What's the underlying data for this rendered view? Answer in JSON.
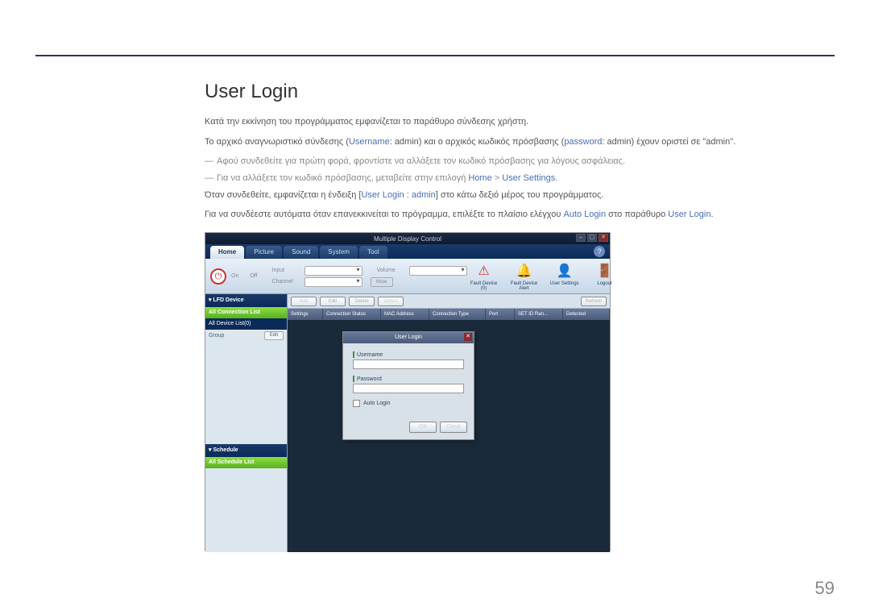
{
  "document": {
    "title": "User Login",
    "page_number": "59",
    "paragraphs": {
      "p1": "Κατά την εκκίνηση του προγράμματος εμφανίζεται το παράθυρο σύνδεσης χρήστη.",
      "p2a": "Το αρχικό αναγνωριστικό σύνδεσης (",
      "p2b": "Username",
      "p2c": ": admin) και ο αρχικός κωδικός πρόσβασης (",
      "p2d": "password",
      "p2e": ": admin) έχουν οριστεί σε \"admin\".",
      "d1": "Αφού συνδεθείτε για πρώτη φορά, φροντίστε να αλλάξετε τον κωδικό πρόσβασης για λόγους ασφάλειας.",
      "d2a": "Για να αλλάξετε τον κωδικό πρόσβασης, μεταβείτε στην επιλογή ",
      "d2b": "Home",
      "d2c": " > ",
      "d2d": "User Settings",
      "d2e": ".",
      "p3a": "Όταν συνδεθείτε, εμφανίζεται η ένδειξη [",
      "p3b": "User Login : admin",
      "p3c": "] στο κάτω δεξιό μέρος του προγράμματος.",
      "p4a": "Για να συνδέεστε αυτόματα όταν επανεκκινείται το πρόγραμμα, επιλέξτε το πλαίσιο ελέγχου ",
      "p4b": "Auto Login",
      "p4c": " στο παράθυρο ",
      "p4d": "User Login",
      "p4e": "."
    }
  },
  "app": {
    "window_title": "Multiple Display Control",
    "help": "?",
    "tabs": [
      "Home",
      "Picture",
      "Sound",
      "System",
      "Tool"
    ],
    "toolbar": {
      "on": "On",
      "off": "Off",
      "input_label": "Input",
      "channel_label": "Channel",
      "volume_label": "Volume",
      "mute": "Mute",
      "icons": [
        {
          "name": "fault-device-icon",
          "glyph": "❗",
          "label": "Fault Device (0)"
        },
        {
          "name": "fault-alert-icon",
          "glyph": "🔔",
          "label": "Fault Device Alert"
        },
        {
          "name": "user-settings-icon",
          "glyph": "👤",
          "label": "User Settings"
        },
        {
          "name": "logout-icon",
          "glyph": "🚪",
          "label": "Logout"
        }
      ]
    },
    "sidebar": {
      "lfd_header": "▾ LFD Device",
      "all_connection": "All Connection List",
      "all_device": "All Device List(0)",
      "group": "Group",
      "edit": "Edit",
      "schedule_header": "▾ Schedule",
      "all_schedule": "All Schedule List"
    },
    "crud": {
      "add": "Add",
      "edit": "Edit",
      "delete": "Delete",
      "detect": "Detect",
      "refresh": "Refresh"
    },
    "table_headers": [
      "Settings",
      "Connection Status",
      "MAC Address",
      "Connection Type",
      "Port",
      "SET ID Ran...",
      "Detected"
    ],
    "login": {
      "title": "User Login",
      "username": "Username",
      "password": "Password",
      "auto": "Auto Login",
      "ok": "OK",
      "close": "Close"
    }
  }
}
